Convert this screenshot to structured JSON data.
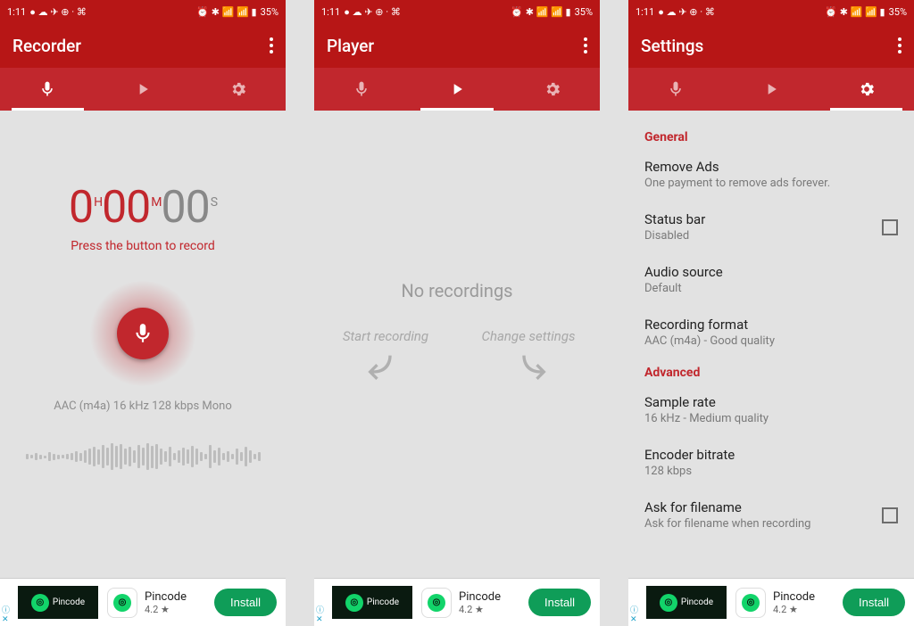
{
  "status": {
    "time": "1:11",
    "battery": "35%"
  },
  "screens": {
    "recorder": {
      "title": "Recorder",
      "timer_h": "0",
      "timer_h_unit": "H",
      "timer_m": "00",
      "timer_m_unit": "M",
      "timer_s": "00",
      "timer_s_unit": "S",
      "hint": "Press the button to record",
      "format": "AAC (m4a) 16 kHz 128 kbps Mono"
    },
    "player": {
      "title": "Player",
      "empty": "No recordings",
      "hint_left": "Start recording",
      "hint_right": "Change settings"
    },
    "settings": {
      "title": "Settings",
      "section_general": "General",
      "remove_ads_title": "Remove Ads",
      "remove_ads_sub": "One payment to remove ads forever.",
      "statusbar_title": "Status bar",
      "statusbar_sub": "Disabled",
      "audio_source_title": "Audio source",
      "audio_source_sub": "Default",
      "rec_format_title": "Recording format",
      "rec_format_sub": "AAC (m4a) - Good quality",
      "section_advanced": "Advanced",
      "sample_rate_title": "Sample rate",
      "sample_rate_sub": "16 kHz - Medium quality",
      "encoder_title": "Encoder bitrate",
      "encoder_sub": "128 kbps",
      "ask_filename_title": "Ask for filename",
      "ask_filename_sub": "Ask for filename when recording"
    }
  },
  "ad": {
    "brand": "Pincode",
    "name": "Pincode",
    "rating": "4.2 ★",
    "cta": "Install"
  }
}
